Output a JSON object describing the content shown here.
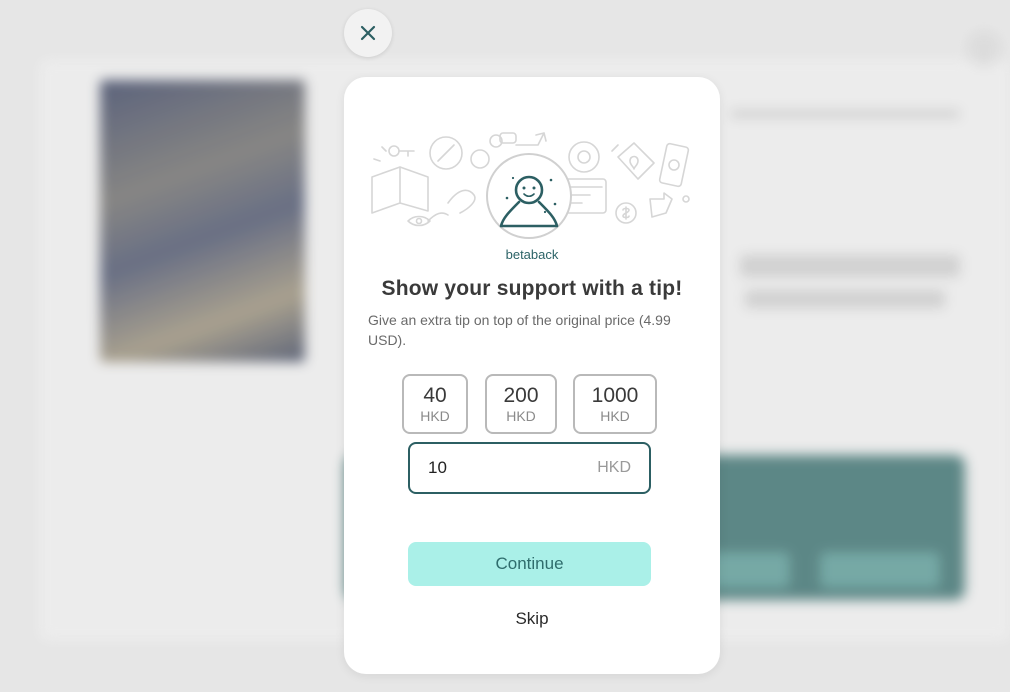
{
  "creator": {
    "name": "betaback"
  },
  "dialog": {
    "title": "Show your support with a tip!",
    "description": "Give an extra tip on top of the original price (4.99 USD).",
    "tip_options": [
      {
        "amount": "40",
        "currency": "HKD"
      },
      {
        "amount": "200",
        "currency": "HKD"
      },
      {
        "amount": "1000",
        "currency": "HKD"
      }
    ],
    "custom_tip": {
      "value": "10",
      "currency": "HKD"
    },
    "continue_label": "Continue",
    "skip_label": "Skip"
  },
  "icons": {
    "close": "close-icon",
    "avatar": "user-avatar-icon"
  },
  "colors": {
    "accent": "#2c5f63",
    "continue_bg": "#aaf0e8",
    "continue_text": "#2f6d6d",
    "backdrop": "#e6e6e6"
  }
}
